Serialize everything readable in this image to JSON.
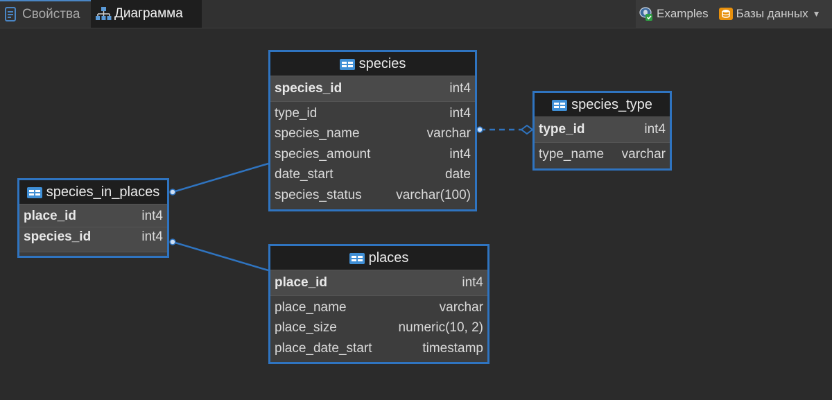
{
  "tabs": {
    "properties": "Свойства",
    "diagram": "Диаграмма"
  },
  "toolbar": {
    "examples": "Examples",
    "databases": "Базы данных"
  },
  "colors": {
    "accent": "#2f74c0",
    "background": "#2b2b2b",
    "header": "#1e1e1e"
  },
  "entities": {
    "species": {
      "name": "species",
      "pk": {
        "name": "species_id",
        "type": "int4"
      },
      "columns": [
        {
          "name": "type_id",
          "type": "int4"
        },
        {
          "name": "species_name",
          "type": "varchar"
        },
        {
          "name": "species_amount",
          "type": "int4"
        },
        {
          "name": "date_start",
          "type": "date"
        },
        {
          "name": "species_status",
          "type": "varchar(100)"
        }
      ]
    },
    "species_type": {
      "name": "species_type",
      "pk": {
        "name": "type_id",
        "type": "int4"
      },
      "columns": [
        {
          "name": "type_name",
          "type": "varchar"
        }
      ]
    },
    "species_in_places": {
      "name": "species_in_places",
      "pk": [
        {
          "name": "place_id",
          "type": "int4"
        },
        {
          "name": "species_id",
          "type": "int4"
        }
      ]
    },
    "places": {
      "name": "places",
      "pk": {
        "name": "place_id",
        "type": "int4"
      },
      "columns": [
        {
          "name": "place_name",
          "type": "varchar"
        },
        {
          "name": "place_size",
          "type": "numeric(10, 2)"
        },
        {
          "name": "place_date_start",
          "type": "timestamp"
        }
      ]
    }
  }
}
